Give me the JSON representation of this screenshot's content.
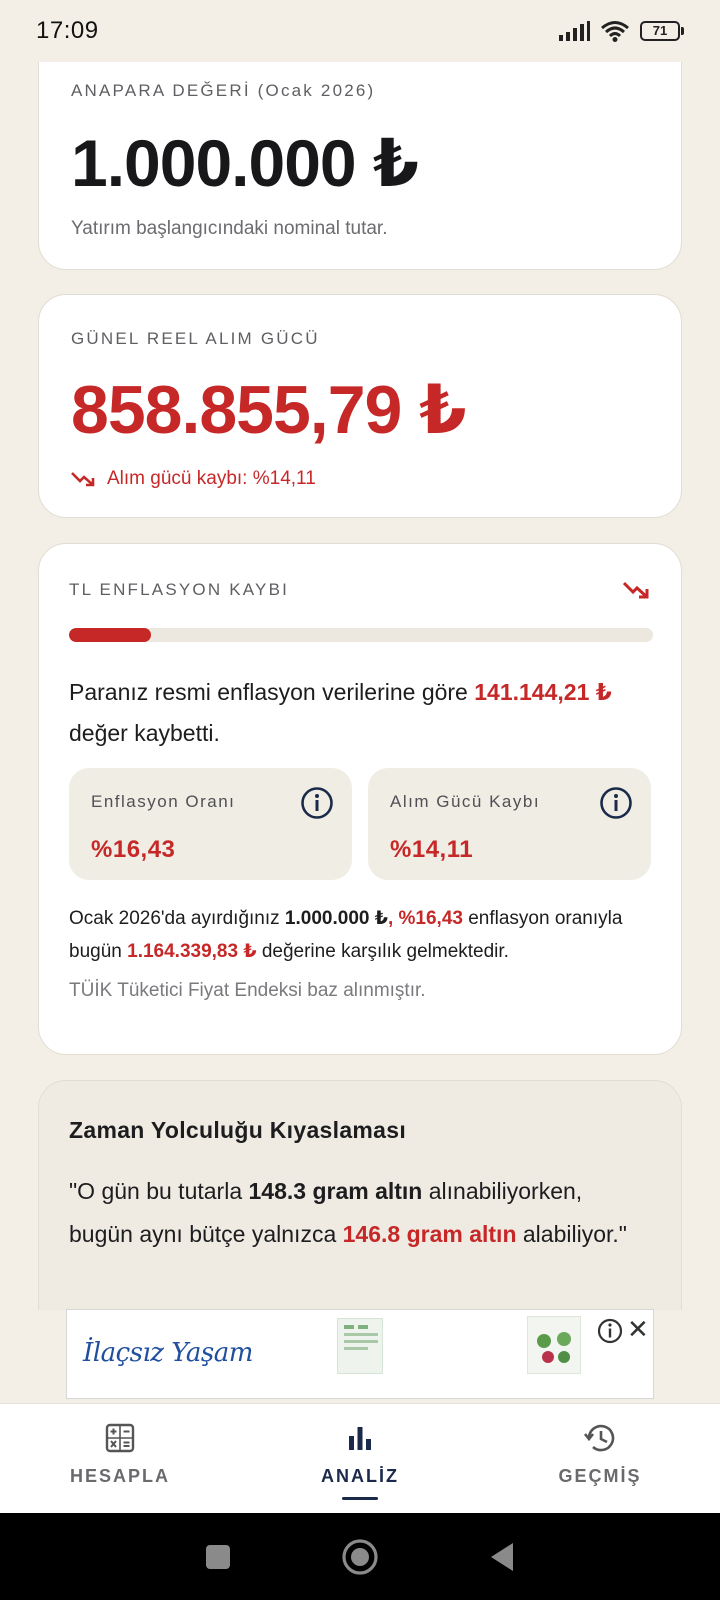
{
  "status_bar": {
    "time": "17:09",
    "battery": "71"
  },
  "principal_card": {
    "label": "ANAPARA DEĞERİ (Ocak 2026)",
    "amount": "1.000.000 ₺",
    "subtitle": "Yatırım başlangıcındaki nominal tutar."
  },
  "real_value_card": {
    "label": "GÜNEL REEL ALIM GÜCÜ",
    "amount": "858.855,79 ₺",
    "loss_text": "Alım gücü kaybı: %14,11"
  },
  "inflation_card": {
    "label": "TL ENFLASYON KAYBI",
    "progress_fraction": 0.1411,
    "text_before": "Paranız resmi enflasyon verilerine göre ",
    "text_amount": "141.144,21 ₺",
    "text_after": " değer kaybetti.",
    "stats": [
      {
        "label": "Enflasyon Oranı",
        "value": "%16,43"
      },
      {
        "label": "Alım Gücü Kaybı",
        "value": "%14,11"
      }
    ],
    "desc_1": "Ocak 2026'da ayırdığınız ",
    "desc_principal": "1.000.000 ₺",
    "desc_rate": ", %16,43",
    "desc_2": " enflasyon oranıyla bugün ",
    "desc_value": "1.164.339,83 ₺",
    "desc_3": " değerine karşılık gelmektedir.",
    "note": "TÜİK Tüketici Fiyat Endeksi baz alınmıştır."
  },
  "comparison_card": {
    "title": "Zaman Yolculuğu Kıyaslaması",
    "q1": "\"O gün bu tutarla ",
    "q_then": "148.3 gram altın",
    "q2": " alınabiliyorken, bugün aynı bütçe yalnızca ",
    "q_now": "146.8 gram altın",
    "q3": " alabiliyor.\""
  },
  "ad": {
    "brand": "İlaçsız Yaşam"
  },
  "bottom_nav": {
    "items": [
      {
        "label": "HESAPLA",
        "icon": "calculator-icon"
      },
      {
        "label": "ANALİZ",
        "icon": "bar-chart-icon"
      },
      {
        "label": "GEÇMİŞ",
        "icon": "history-icon"
      }
    ],
    "active": "ANALİZ"
  },
  "colors": {
    "accent_red": "#c62828",
    "navy": "#1b2a4a",
    "background": "#f3efe6"
  }
}
